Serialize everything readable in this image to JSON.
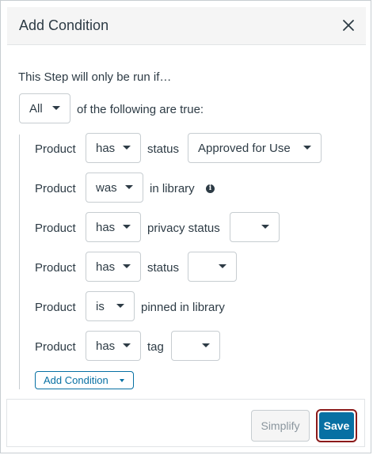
{
  "dialog": {
    "title": "Add Condition",
    "close_icon": "close-icon"
  },
  "intro": {
    "text": "This Step will only be run if…",
    "quantifier": "All",
    "suffix": "of the following are true:"
  },
  "conditions": [
    {
      "subject": "Product",
      "operator": "has",
      "field": "status",
      "value": "Approved for Use"
    },
    {
      "subject": "Product",
      "operator": "was",
      "field": "in library",
      "info_icon": "info-icon"
    },
    {
      "subject": "Product",
      "operator": "has",
      "field": "privacy status",
      "value": ""
    },
    {
      "subject": "Product",
      "operator": "has",
      "field": "status",
      "value": ""
    },
    {
      "subject": "Product",
      "operator": "is",
      "field": "pinned in library"
    },
    {
      "subject": "Product",
      "operator": "has",
      "field": "tag",
      "value": ""
    }
  ],
  "add_condition_label": "Add Condition",
  "footer": {
    "simplify_label": "Simplify",
    "save_label": "Save"
  },
  "colors": {
    "primary": "#0770a3",
    "focus_ring": "#8b1a1a",
    "text": "#2d3b45"
  }
}
